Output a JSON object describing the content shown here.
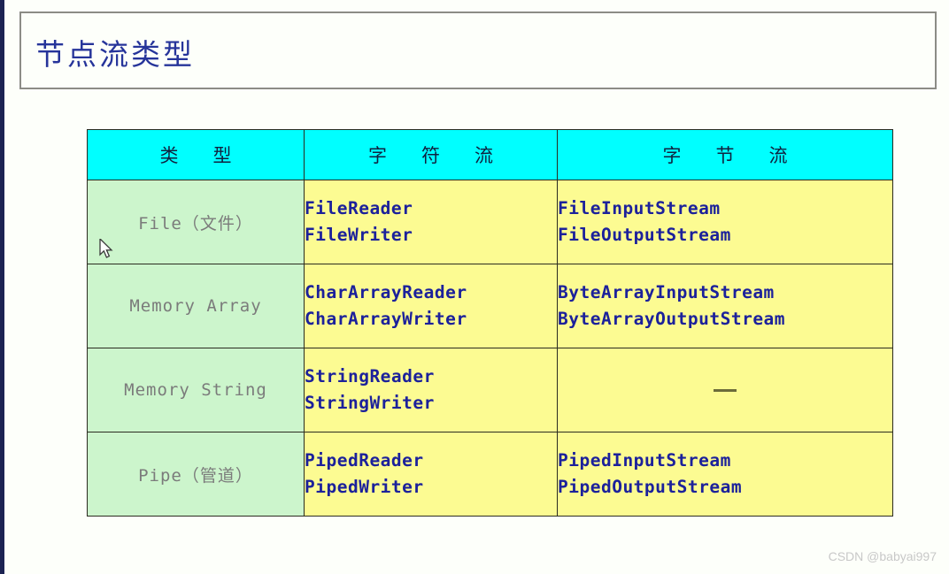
{
  "slide": {
    "title": "节点流类型",
    "background_color": "#fdfffa",
    "title_color": "#26349a",
    "edge_strip_color": "#1c2352"
  },
  "table": {
    "header_bg": "#00ffff",
    "type_column_bg": "#ccf5cc",
    "stream_column_bg": "#fcfb92",
    "stream_text_color": "#1c219b",
    "type_text_color": "#7b7b7b",
    "headers": {
      "type": "类　型",
      "char_stream": "字　符　流",
      "byte_stream": "字　节　流"
    },
    "rows": [
      {
        "type": "File（文件）",
        "char_stream": [
          "FileReader",
          "FileWriter"
        ],
        "byte_stream": [
          "FileInputStream",
          "FileOutputStream"
        ]
      },
      {
        "type": "Memory Array",
        "char_stream": [
          "CharArrayReader",
          "CharArrayWriter"
        ],
        "byte_stream": [
          "ByteArrayInputStream",
          "ByteArrayOutputStream"
        ]
      },
      {
        "type": "Memory String",
        "char_stream": [
          "StringReader",
          "StringWriter"
        ],
        "byte_stream": [
          "—"
        ]
      },
      {
        "type": "Pipe（管道）",
        "char_stream": [
          "PipedReader",
          "PipedWriter"
        ],
        "byte_stream": [
          "PipedInputStream",
          "PipedOutputStream"
        ]
      }
    ]
  },
  "watermark": {
    "text": "CSDN @babyai997"
  },
  "cursor": {
    "icon": "arrow-pointer"
  }
}
